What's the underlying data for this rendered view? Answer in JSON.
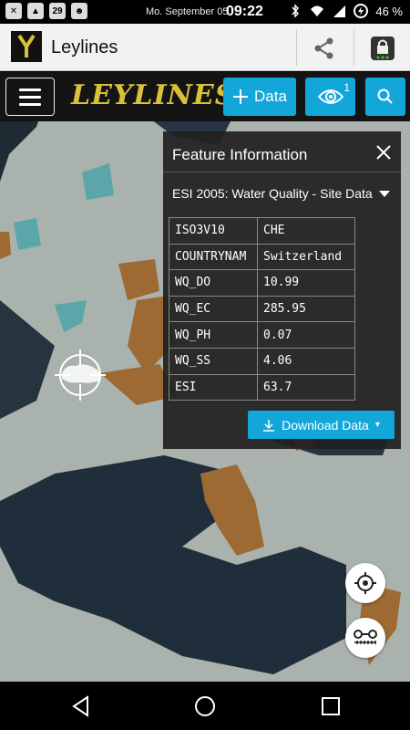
{
  "status_bar": {
    "notification_icons": [
      "close-icon",
      "image-icon",
      "calendar-icon",
      "android-icon"
    ],
    "calendar_day": "29",
    "date": "Mo. September 05",
    "time": "09:22",
    "battery": "46 %"
  },
  "app_bar": {
    "title": "Leylines",
    "actions": [
      "share-icon",
      "lock-icon"
    ]
  },
  "toolbar": {
    "brand": "LEYLINES.CH",
    "data_button_label": "Data",
    "visible_layers_count": "1"
  },
  "feature_panel": {
    "title": "Feature Information",
    "selected_layer": "ESI 2005: Water Quality - Site Data",
    "attributes": [
      {
        "key": "ISO3V10",
        "value": "CHE"
      },
      {
        "key": "COUNTRYNAM",
        "value": "Switzerland"
      },
      {
        "key": "WQ_DO",
        "value": "10.99"
      },
      {
        "key": "WQ_EC",
        "value": "285.95"
      },
      {
        "key": "WQ_PH",
        "value": "0.07"
      },
      {
        "key": "WQ_SS",
        "value": "4.06"
      },
      {
        "key": "ESI",
        "value": "63.7"
      }
    ],
    "download_label": "Download Data",
    "download_caret": "▾"
  },
  "map": {
    "highlight_color": "#9c6a32",
    "water_color": "#5aa6a8",
    "base_color": "#9aa7a9"
  },
  "colors": {
    "accent": "#13a6d9",
    "brand_yellow": "#d9c23a"
  }
}
